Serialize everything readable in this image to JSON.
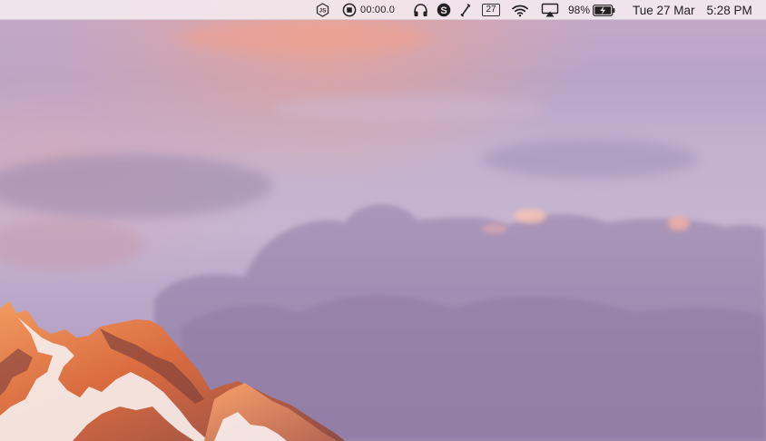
{
  "menubar": {
    "node_icon": "nodejs-icon",
    "recording_time": "00:00.0",
    "calendar_day": "27",
    "battery_percent": "98%",
    "date": "Tue 27 Mar",
    "time": "5:28 PM"
  },
  "colors": {
    "menubar_bg": "#f2e8ee",
    "sky_top": "#c7a9c8",
    "sky_mid": "#c3b2cf",
    "mountain_light": "#e9874f",
    "snow": "#f7eef0"
  }
}
